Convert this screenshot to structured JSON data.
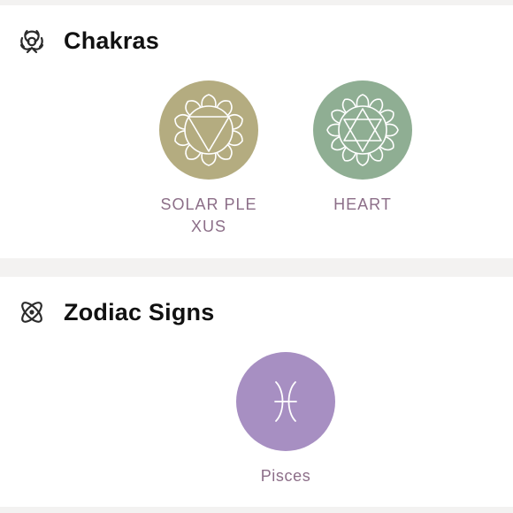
{
  "sections": [
    {
      "title": "Chakras",
      "icon": "biohazard-icon",
      "items": [
        {
          "label": "SOLAR PLEXUS",
          "icon": "solar-plexus-chakra-icon",
          "color": "#b4ac80"
        },
        {
          "label": "HEART",
          "icon": "heart-chakra-icon",
          "color": "#8fae93"
        }
      ]
    },
    {
      "title": "Zodiac Signs",
      "icon": "atom-icon",
      "items": [
        {
          "label": "Pisces",
          "icon": "pisces-symbol-icon",
          "color": "#a78fc2"
        }
      ]
    }
  ],
  "colors": {
    "background": "#f3f2f1",
    "card": "#ffffff",
    "label": "#8c6e88",
    "title": "#111111"
  }
}
